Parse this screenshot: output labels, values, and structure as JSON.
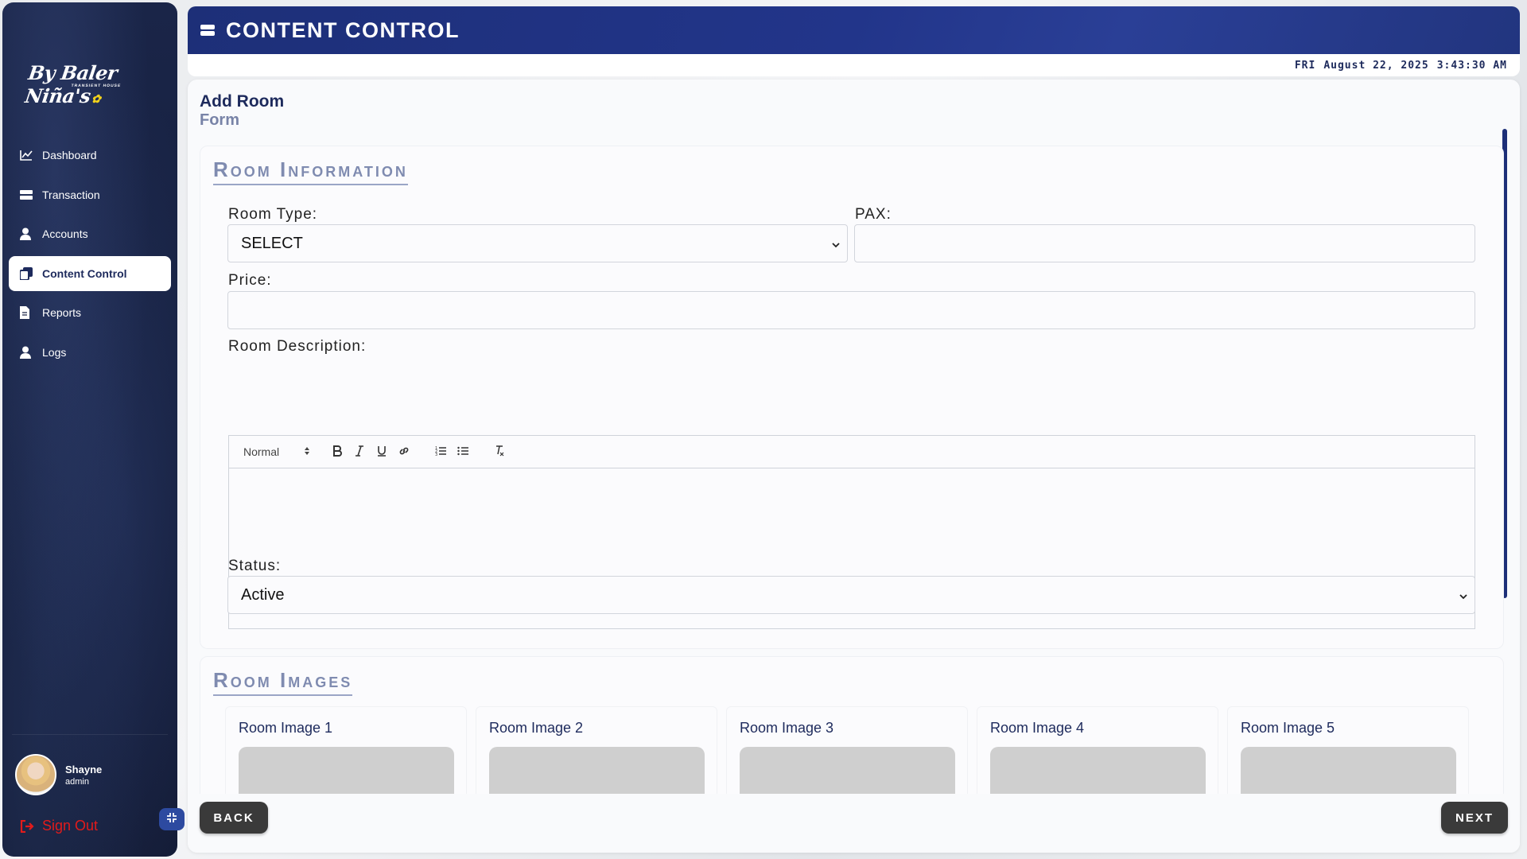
{
  "sidebar": {
    "logo_text": "By Baler Niña's",
    "logo_sub": "TRANSIENT HOUSE",
    "items": [
      {
        "label": "Dashboard",
        "icon": "chart-line-icon",
        "active": false
      },
      {
        "label": "Transaction",
        "icon": "server-icon",
        "active": false
      },
      {
        "label": "Accounts",
        "icon": "user-icon",
        "active": false
      },
      {
        "label": "Content Control",
        "icon": "copy-icon",
        "active": true
      },
      {
        "label": "Reports",
        "icon": "file-icon",
        "active": false
      },
      {
        "label": "Logs",
        "icon": "user-icon",
        "active": false
      }
    ],
    "user": {
      "name": "Shayne",
      "role": "admin"
    },
    "signout_label": "Sign Out"
  },
  "header": {
    "title": "CONTENT CONTROL",
    "icon": "server-icon"
  },
  "datetime": {
    "day": "FRI",
    "date": "August 22, 2025",
    "time": "3:43:30 AM"
  },
  "page": {
    "title": "Add Room",
    "subtitle": "Form"
  },
  "room_info": {
    "title": "Room Information",
    "room_type_label": "Room Type:",
    "room_type_value": "SELECT",
    "pax_label": "PAX:",
    "pax_value": "",
    "price_label": "Price:",
    "price_value": "",
    "description_label": "Room Description:",
    "editor_format": "Normal",
    "status_label": "Status:",
    "status_value": "Active"
  },
  "room_images": {
    "title": "Room Images",
    "items": [
      {
        "label": "Room Image 1"
      },
      {
        "label": "Room Image 2"
      },
      {
        "label": "Room Image 3"
      },
      {
        "label": "Room Image 4"
      },
      {
        "label": "Room Image 5"
      }
    ]
  },
  "buttons": {
    "back": "BACK",
    "next": "NEXT"
  },
  "colors": {
    "primary": "#1d2f78",
    "accent_yellow": "#f2d21b",
    "danger": "#e21b1b",
    "button_dark": "#3a3a3a"
  }
}
